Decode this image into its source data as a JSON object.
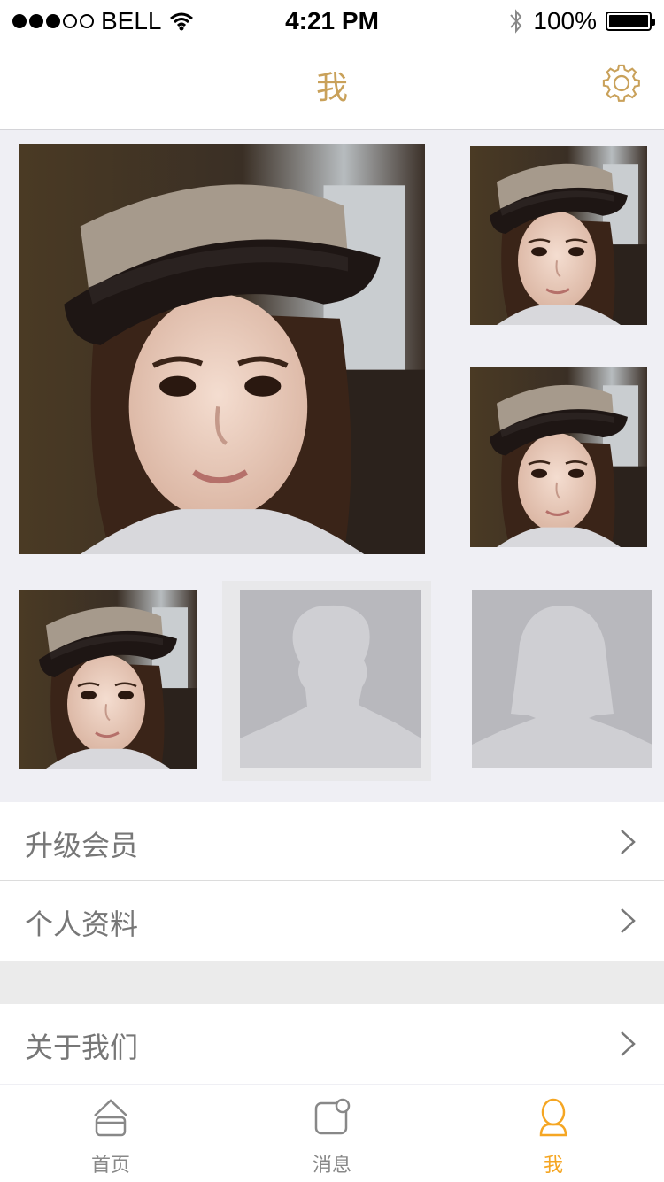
{
  "status_bar": {
    "carrier": "BELL",
    "time": "4:21 PM",
    "battery": "100%"
  },
  "nav": {
    "title": "我",
    "settings_icon": "gear-icon"
  },
  "photos": {
    "items": [
      "user-photo",
      "user-photo",
      "user-photo",
      "user-photo"
    ],
    "placeholders": [
      "male-avatar-placeholder",
      "female-avatar-placeholder"
    ]
  },
  "menu": {
    "group1": [
      {
        "label": "升级会员"
      },
      {
        "label": "个人资料"
      }
    ],
    "group2": [
      {
        "label": "关于我们"
      }
    ]
  },
  "tabs": [
    {
      "label": "首页",
      "icon": "home-icon",
      "active": false
    },
    {
      "label": "消息",
      "icon": "message-icon",
      "active": false
    },
    {
      "label": "我",
      "icon": "person-icon",
      "active": true
    }
  ],
  "colors": {
    "accent": "#c9a15a",
    "tab_active": "#f5a623",
    "background": "#efeff4"
  }
}
